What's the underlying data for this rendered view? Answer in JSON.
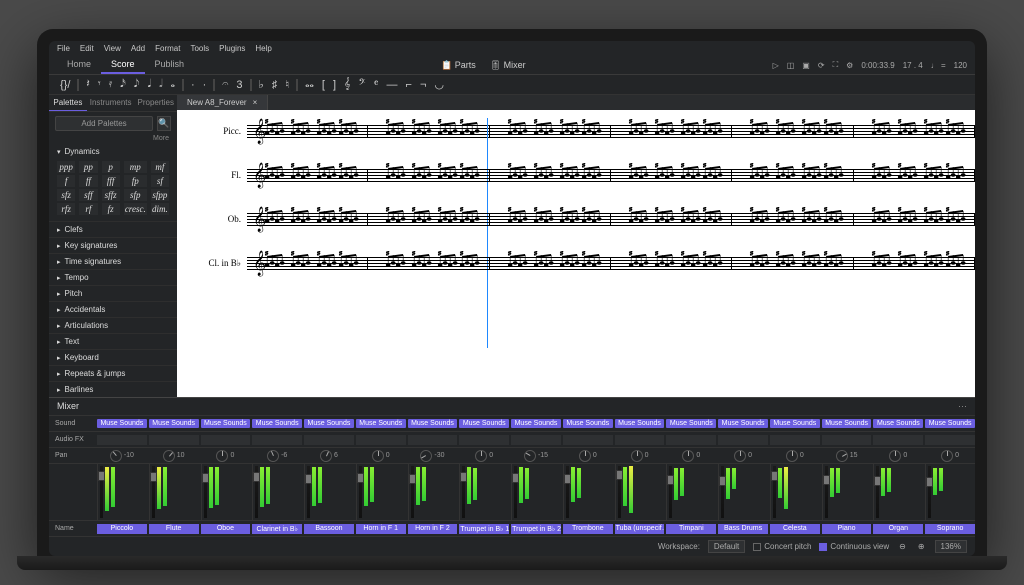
{
  "menubar": [
    "File",
    "Edit",
    "View",
    "Add",
    "Format",
    "Tools",
    "Plugins",
    "Help"
  ],
  "main_tabs": [
    "Home",
    "Score",
    "Publish"
  ],
  "active_tab": 1,
  "center_toggles": [
    "📋 Parts",
    "🎚 Mixer"
  ],
  "right_toolbar": {
    "icons": [
      "▷",
      "◫",
      "▣",
      "⟳",
      "⛶",
      "⚙"
    ],
    "time": "0:00:33.9",
    "beat": "17 . 4",
    "tempo_label": "♩ =",
    "tempo": "120"
  },
  "notebar": [
    "{}/",
    "𝄽",
    "𝄾",
    "𝄿",
    "𝅘𝅥𝅯",
    "𝅘𝅥𝅮",
    "𝅘𝅥",
    "𝅗𝅥",
    "𝅝",
    " · ",
    " · ",
    "𝄐",
    "3",
    "♭",
    "♯",
    "♮",
    "𝅝𝅝",
    "[",
    "]",
    "𝄞",
    "𝄢",
    "𝄴",
    "—",
    "⌐",
    "¬",
    "◡"
  ],
  "panel_tabs": [
    "Palettes",
    "Instruments",
    "Properties"
  ],
  "active_panel": 0,
  "add_palettes": "Add Palettes",
  "more": "More",
  "dynamics_header": "Dynamics",
  "dynamics": [
    "ppp",
    "pp",
    "p",
    "mp",
    "mf",
    "f",
    "ff",
    "fff",
    "fp",
    "sf",
    "sfz",
    "sff",
    "sffz",
    "sfp",
    "sfpp",
    "rfz",
    "rf",
    "fz",
    "cresc.",
    "dim."
  ],
  "palette_list": [
    "Clefs",
    "Key signatures",
    "Time signatures",
    "Tempo",
    "Pitch",
    "Accidentals",
    "Articulations",
    "Text",
    "Keyboard",
    "Repeats & jumps",
    "Barlines"
  ],
  "file_tab": "New A8_Forever",
  "instruments_score": [
    "Picc.",
    "Fl.",
    "Ob.",
    "Cl. in B♭"
  ],
  "mixer_header": "Mixer",
  "row_labels": {
    "sound": "Sound",
    "fx": "Audio FX",
    "pan": "Pan",
    "name": "Name"
  },
  "sound_tag": "Muse Sounds",
  "tracks": [
    {
      "name": "Piccolo",
      "pan": -10,
      "fader": 72,
      "meter": [
        85,
        78
      ]
    },
    {
      "name": "Flute",
      "pan": 10,
      "fader": 70,
      "meter": [
        82,
        74
      ]
    },
    {
      "name": "Oboe",
      "pan": 0,
      "fader": 68,
      "meter": [
        80,
        72
      ]
    },
    {
      "name": "Clarinet in B♭",
      "pan": -6,
      "fader": 70,
      "meter": [
        78,
        70
      ]
    },
    {
      "name": "Bassoon",
      "pan": 6,
      "fader": 66,
      "meter": [
        76,
        68
      ]
    },
    {
      "name": "Horn in F 1",
      "pan": 0,
      "fader": 68,
      "meter": [
        74,
        66
      ]
    },
    {
      "name": "Horn in F 2",
      "pan": -30,
      "fader": 66,
      "meter": [
        72,
        64
      ]
    },
    {
      "name": "Trumpet in B♭ 1",
      "pan": 0,
      "fader": 70,
      "meter": [
        70,
        62
      ]
    },
    {
      "name": "Trumpet in B♭ 2",
      "pan": -15,
      "fader": 68,
      "meter": [
        68,
        60
      ]
    },
    {
      "name": "Trombone",
      "pan": 0,
      "fader": 66,
      "meter": [
        66,
        58
      ]
    },
    {
      "name": "Tuba (unspecif…",
      "pan": 0,
      "fader": 74,
      "meter": [
        74,
        90
      ]
    },
    {
      "name": "Timpani",
      "pan": 0,
      "fader": 64,
      "meter": [
        62,
        54
      ]
    },
    {
      "name": "Bass Drums",
      "pan": 0,
      "fader": 62,
      "meter": [
        60,
        40
      ]
    },
    {
      "name": "Celesta",
      "pan": 0,
      "fader": 72,
      "meter": [
        58,
        82
      ]
    },
    {
      "name": "Piano",
      "pan": 15,
      "fader": 64,
      "meter": [
        56,
        48
      ]
    },
    {
      "name": "Organ",
      "pan": 0,
      "fader": 62,
      "meter": [
        54,
        46
      ]
    },
    {
      "name": "Soprano",
      "pan": 0,
      "fader": 60,
      "meter": [
        52,
        44
      ]
    }
  ],
  "status": {
    "workspace_label": "Workspace:",
    "workspace": "Default",
    "concert_pitch": "Concert pitch",
    "view": "Continuous view",
    "zoom": "136%"
  }
}
